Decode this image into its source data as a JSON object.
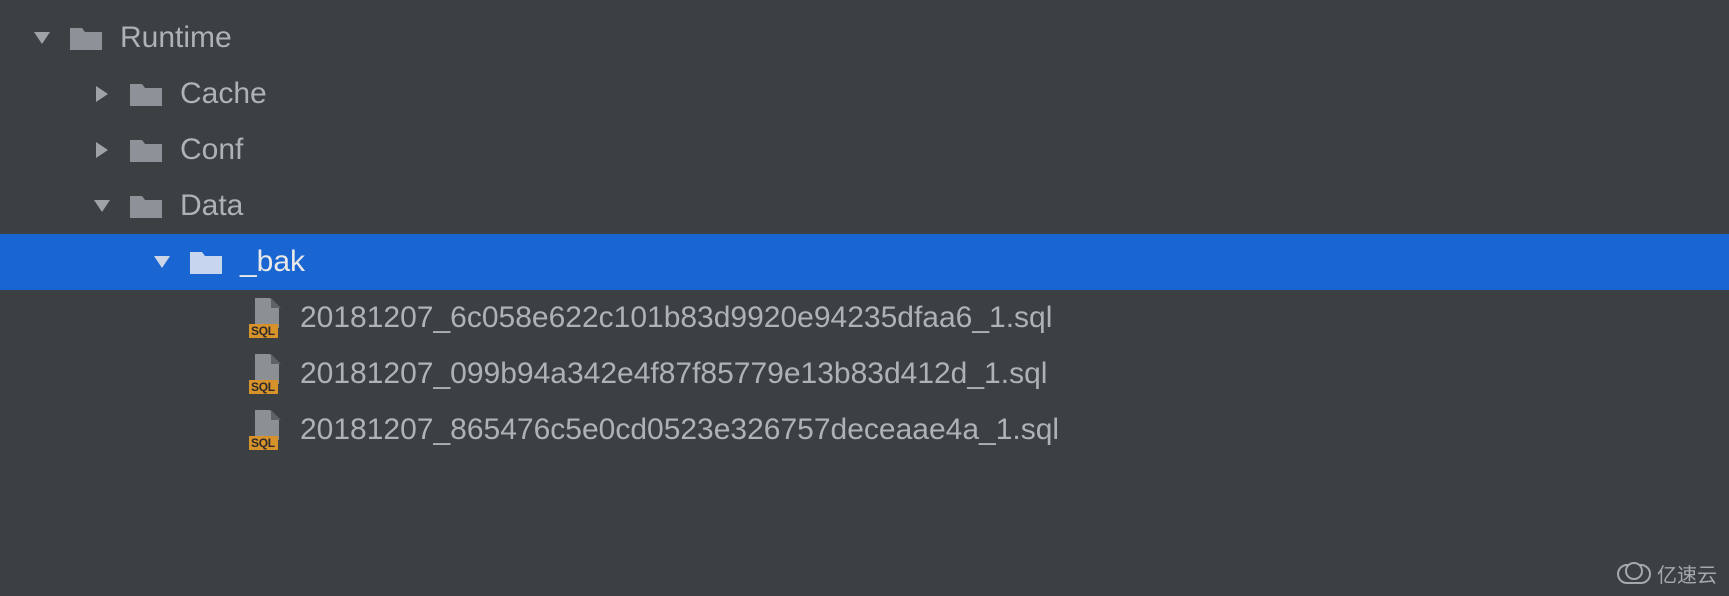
{
  "tree": {
    "root": {
      "label": "Runtime"
    },
    "cache": {
      "label": "Cache"
    },
    "conf": {
      "label": "Conf"
    },
    "data": {
      "label": "Data"
    },
    "bak": {
      "label": "_bak"
    },
    "files": [
      {
        "label": "20181207_6c058e622c101b83d9920e94235dfaa6_1.sql",
        "badge": "SQL"
      },
      {
        "label": "20181207_099b94a342e4f87f85779e13b83d412d_1.sql",
        "badge": "SQL"
      },
      {
        "label": "20181207_865476c5e0cd0523e326757deceaae4a_1.sql",
        "badge": "SQL"
      }
    ]
  },
  "watermark": {
    "label": "亿速云"
  }
}
